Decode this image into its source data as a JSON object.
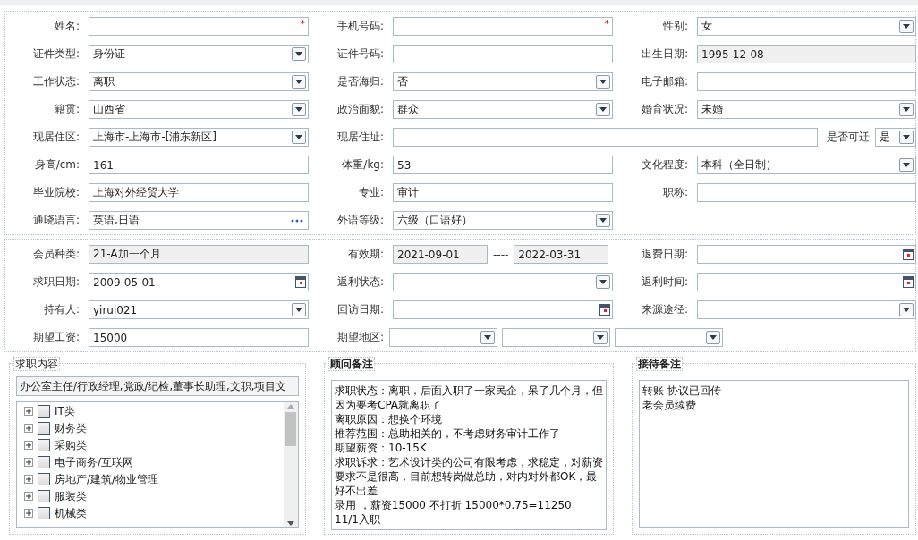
{
  "basic_info": {
    "rows": [
      [
        {
          "label": "姓名:",
          "kind": "text",
          "required_mark": "*"
        },
        {
          "label": "手机号码:",
          "kind": "text",
          "required_mark": "*"
        },
        {
          "label": "性别:",
          "kind": "select",
          "value": "女"
        }
      ],
      [
        {
          "label": "证件类型:",
          "kind": "select",
          "value": "身份证"
        },
        {
          "label": "证件号码:",
          "kind": "text"
        },
        {
          "label": "出生日期:",
          "kind": "readonly",
          "value": "1995-12-08"
        }
      ],
      [
        {
          "label": "工作状态:",
          "kind": "select",
          "value": "离职"
        },
        {
          "label": "是否海归:",
          "kind": "select",
          "value": "否"
        },
        {
          "label": "电子邮箱:",
          "kind": "text"
        }
      ],
      [
        {
          "label": "籍贯:",
          "kind": "select",
          "value": "山西省"
        },
        {
          "label": "政治面貌:",
          "kind": "select",
          "value": "群众"
        },
        {
          "label": "婚育状况:",
          "kind": "select",
          "value": "未婚"
        }
      ],
      [
        {
          "label": "现居住区:",
          "kind": "select",
          "value": " 上海市-上海市-[浦东新区]"
        },
        {
          "label": "现居住址:",
          "kind": "text",
          "extra": {
            "label": "是否可迁",
            "kind": "select",
            "value": "是"
          }
        }
      ],
      [
        {
          "label": "身高/cm:",
          "kind": "text",
          "value": "161"
        },
        {
          "label": "体重/kg:",
          "kind": "text",
          "value": "53"
        },
        {
          "label": "文化程度:",
          "kind": "select",
          "value": "本科（全日制）"
        }
      ],
      [
        {
          "label": "毕业院校:",
          "kind": "text",
          "value": "上海对外经贸大学"
        },
        {
          "label": "专业:",
          "kind": "text",
          "value": "审计"
        },
        {
          "label": "职称:",
          "kind": "text"
        }
      ],
      [
        {
          "label": "通晓语言:",
          "kind": "lookup",
          "value": "英语,日语"
        },
        {
          "label": "外语等级:",
          "kind": "select",
          "value": "六级（口语好）"
        }
      ]
    ]
  },
  "membership": {
    "rows": [
      [
        {
          "label": "会员种类:",
          "kind": "readonly",
          "value": "21-A加一个月"
        },
        {
          "label": "有效期:",
          "kind": "range",
          "values": [
            "2021-09-01",
            "2022-03-31"
          ],
          "separator": "----"
        },
        {
          "label": "退费日期:",
          "kind": "date"
        }
      ],
      [
        {
          "label": "求职日期:",
          "kind": "date",
          "value": "2009-05-01"
        },
        {
          "label": "返利状态:",
          "kind": "select"
        },
        {
          "label": "返利时间:",
          "kind": "date"
        }
      ],
      [
        {
          "label": "持有人:",
          "kind": "select",
          "value": "yirui021"
        },
        {
          "label": "回访日期:",
          "kind": "date"
        },
        {
          "label": "来源途径:",
          "kind": "select"
        }
      ],
      [
        {
          "label": "期望工资:",
          "kind": "text",
          "value": "15000"
        },
        {
          "label": "期望地区:",
          "kind": "multi",
          "parts": [
            {
              "kind": "select"
            },
            {
              "kind": "select"
            },
            {
              "kind": "select"
            }
          ]
        }
      ]
    ]
  },
  "job_content": {
    "title": "求职内容",
    "value": "办公室主任/行政经理,党政/纪检,董事长助理,文职,项目文",
    "tree": [
      {
        "label": "IT类",
        "checked": false,
        "expanded": false
      },
      {
        "label": "财务类",
        "checked": false,
        "expanded": false
      },
      {
        "label": "采购类",
        "checked": false,
        "expanded": false
      },
      {
        "label": "电子商务/互联网",
        "checked": false,
        "expanded": false
      },
      {
        "label": "房地产/建筑/物业管理",
        "checked": false,
        "expanded": false
      },
      {
        "label": "服装类",
        "checked": false,
        "expanded": false
      },
      {
        "label": "机械类",
        "checked": false,
        "expanded": false
      }
    ]
  },
  "consultant_notes": {
    "title": "顾问备注",
    "lines": [
      "求职状态：离职，后面入职了一家民企，呆了几个月，但因为要考CPA就离职了",
      "离职原因：想换个环境",
      "推荐范围：总助相关的，不考虑财务审计工作了",
      "期望薪资：10-15K",
      "求职诉求：艺术设计类的公司有限考虑，求稳定，对薪资要求不是很高，目前想转岗做总助，对内对外都OK，最好不出差",
      "录用 ，薪资15000 不打折 15000*0.75=11250",
      "11/1入职"
    ]
  },
  "reception_notes": {
    "title": "接待备注",
    "lines": [
      "转账 协议已回传",
      "老会员续费"
    ]
  }
}
